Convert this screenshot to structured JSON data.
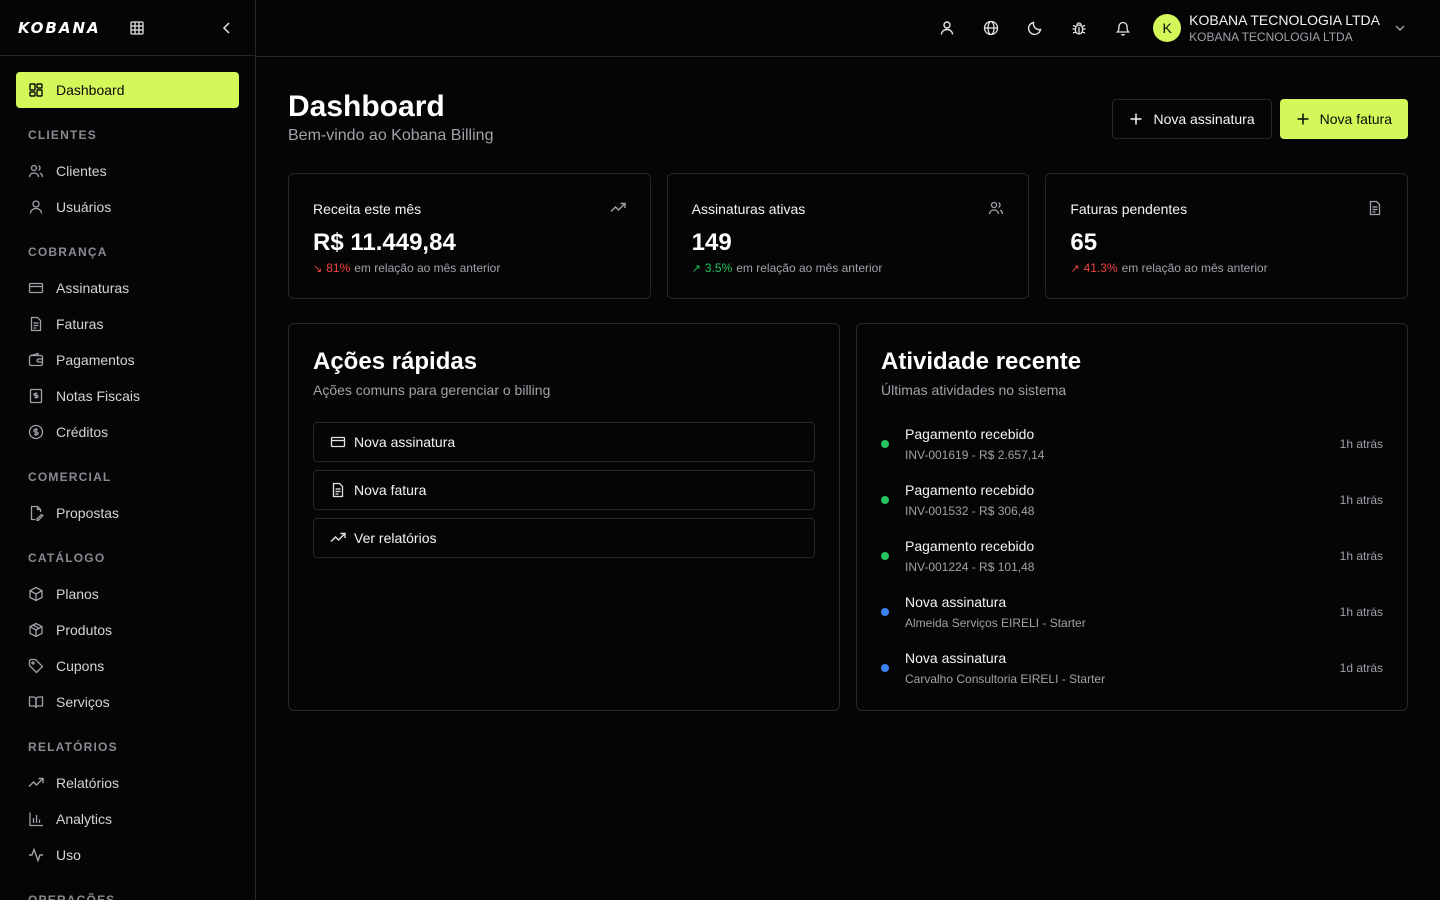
{
  "brand": {
    "logo": "KOBANA",
    "accent": "#d4f85a"
  },
  "sidebar": {
    "active": {
      "label": "Dashboard",
      "icon": "dashboard-icon"
    },
    "sections": [
      {
        "label": "CLIENTES",
        "items": [
          {
            "label": "Clientes",
            "icon": "users-icon"
          },
          {
            "label": "Usuários",
            "icon": "user-icon"
          }
        ]
      },
      {
        "label": "COBRANÇA",
        "items": [
          {
            "label": "Assinaturas",
            "icon": "credit-card-icon"
          },
          {
            "label": "Faturas",
            "icon": "file-icon"
          },
          {
            "label": "Pagamentos",
            "icon": "wallet-icon"
          },
          {
            "label": "Notas Fiscais",
            "icon": "receipt-icon"
          },
          {
            "label": "Créditos",
            "icon": "coin-icon"
          }
        ]
      },
      {
        "label": "COMERCIAL",
        "items": [
          {
            "label": "Propostas",
            "icon": "file-signature-icon"
          }
        ]
      },
      {
        "label": "CATÁLOGO",
        "items": [
          {
            "label": "Planos",
            "icon": "package-icon"
          },
          {
            "label": "Produtos",
            "icon": "box-icon"
          },
          {
            "label": "Cupons",
            "icon": "tag-icon"
          },
          {
            "label": "Serviços",
            "icon": "book-icon"
          }
        ]
      },
      {
        "label": "RELATÓRIOS",
        "items": [
          {
            "label": "Relatórios",
            "icon": "trending-up-icon"
          },
          {
            "label": "Analytics",
            "icon": "bar-chart-icon"
          },
          {
            "label": "Uso",
            "icon": "activity-icon"
          }
        ]
      },
      {
        "label": "OPERAÇÕES",
        "items": []
      }
    ]
  },
  "header": {
    "account_name": "KOBANA TECNOLOGIA LTDA",
    "account_sub": "KOBANA TECNOLOGIA LTDA",
    "avatar_initial": "K"
  },
  "page": {
    "title": "Dashboard",
    "subtitle": "Bem-vindo ao Kobana Billing",
    "btn_new_subscription": "Nova assinatura",
    "btn_new_invoice": "Nova fatura"
  },
  "stats": [
    {
      "label": "Receita este mês",
      "value": "R$ 11.449,84",
      "pct": "81%",
      "trend": "down",
      "suffix": "em relação ao mês anterior",
      "icon": "trending-up-icon"
    },
    {
      "label": "Assinaturas ativas",
      "value": "149",
      "pct": "3.5%",
      "trend": "up",
      "suffix": "em relação ao mês anterior",
      "icon": "users-icon"
    },
    {
      "label": "Faturas pendentes",
      "value": "65",
      "pct": "41.3%",
      "trend": "up-bad",
      "suffix": "em relação ao mês anterior",
      "icon": "file-icon"
    }
  ],
  "quick_actions": {
    "title": "Ações rápidas",
    "subtitle": "Ações comuns para gerenciar o billing",
    "items": [
      "Nova assinatura",
      "Nova fatura",
      "Ver relatórios"
    ]
  },
  "activity": {
    "title": "Atividade recente",
    "subtitle": "Últimas atividades no sistema",
    "items": [
      {
        "title": "Pagamento recebido",
        "detail": "INV-001619 - R$ 2.657,14",
        "time": "1h atrás",
        "color": "#22c55e"
      },
      {
        "title": "Pagamento recebido",
        "detail": "INV-001532 - R$ 306,48",
        "time": "1h atrás",
        "color": "#22c55e"
      },
      {
        "title": "Pagamento recebido",
        "detail": "INV-001224 - R$ 101,48",
        "time": "1h atrás",
        "color": "#22c55e"
      },
      {
        "title": "Nova assinatura",
        "detail": "Almeida Serviços EIRELI - Starter",
        "time": "1h atrás",
        "color": "#3b82f6"
      },
      {
        "title": "Nova assinatura",
        "detail": "Carvalho Consultoria EIRELI - Starter",
        "time": "1d atrás",
        "color": "#3b82f6"
      }
    ]
  }
}
